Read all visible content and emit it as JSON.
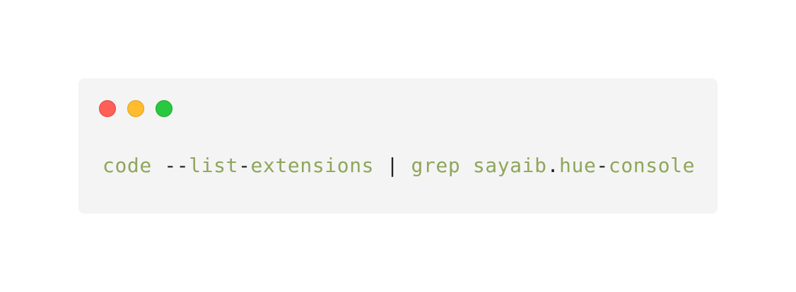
{
  "window": {
    "background": "#f4f4f4",
    "controls": [
      {
        "name": "close",
        "color": "#ff5f57",
        "border": "#e0443e"
      },
      {
        "name": "minimize",
        "color": "#febc2e",
        "border": "#dea123"
      },
      {
        "name": "zoom",
        "color": "#28c840",
        "border": "#1aab29"
      }
    ]
  },
  "command": {
    "tokens": [
      {
        "text": "code",
        "color": "#8ea65b"
      },
      {
        "text": " ",
        "color": "#222222"
      },
      {
        "text": "--",
        "color": "#222222"
      },
      {
        "text": "list",
        "color": "#8ea65b"
      },
      {
        "text": "-",
        "color": "#222222"
      },
      {
        "text": "extensions",
        "color": "#8ea65b"
      },
      {
        "text": " | ",
        "color": "#222222"
      },
      {
        "text": "grep",
        "color": "#8ea65b"
      },
      {
        "text": " ",
        "color": "#222222"
      },
      {
        "text": "sayaib",
        "color": "#8ea65b"
      },
      {
        "text": ".",
        "color": "#222222"
      },
      {
        "text": "hue",
        "color": "#8ea65b"
      },
      {
        "text": "-",
        "color": "#222222"
      },
      {
        "text": "console",
        "color": "#8ea65b"
      }
    ]
  }
}
